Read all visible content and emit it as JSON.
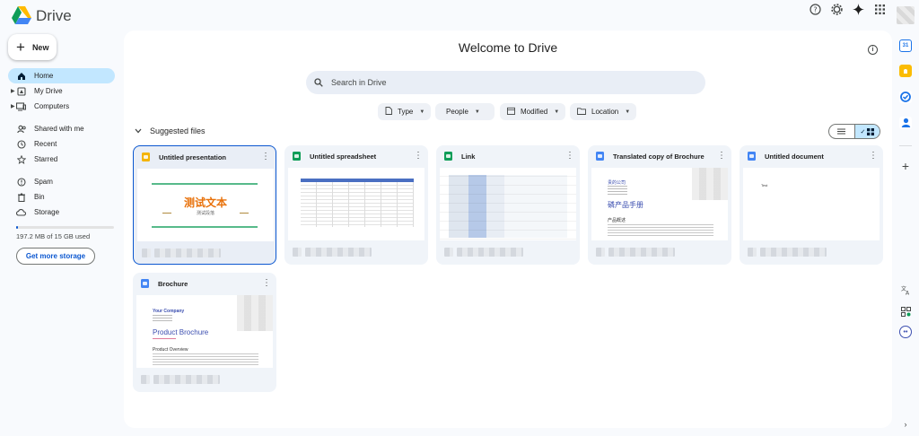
{
  "app": {
    "title": "Drive"
  },
  "topbar": {
    "icons": [
      "help-icon",
      "settings-icon",
      "gemini-icon",
      "apps-grid-icon"
    ]
  },
  "sidebar": {
    "new_label": "New",
    "items": [
      {
        "label": "Home",
        "icon": "home-icon",
        "active": true
      },
      {
        "label": "My Drive",
        "icon": "my-drive-icon",
        "expandable": true
      },
      {
        "label": "Computers",
        "icon": "computers-icon",
        "expandable": true
      },
      {
        "label": "Shared with me",
        "icon": "shared-icon"
      },
      {
        "label": "Recent",
        "icon": "clock-icon"
      },
      {
        "label": "Starred",
        "icon": "star-icon"
      },
      {
        "label": "Spam",
        "icon": "spam-icon"
      },
      {
        "label": "Bin",
        "icon": "bin-icon"
      },
      {
        "label": "Storage",
        "icon": "cloud-icon"
      }
    ],
    "storage": {
      "used_text": "197.2 MB of 15 GB used",
      "used_fraction": 0.013,
      "button_label": "Get more storage"
    }
  },
  "main": {
    "welcome": "Welcome to Drive",
    "search_placeholder": "Search in Drive",
    "filters": [
      {
        "label": "Type",
        "icon": "file-icon"
      },
      {
        "label": "People",
        "icon": ""
      },
      {
        "label": "Modified",
        "icon": "calendar-icon"
      },
      {
        "label": "Location",
        "icon": "folder-icon"
      }
    ],
    "section_title": "Suggested files",
    "files": [
      {
        "name": "Untitled presentation",
        "type": "slides",
        "selected": true,
        "thumb": {
          "title": "测试文本",
          "subtitle": "测试段落"
        }
      },
      {
        "name": "Untitled spreadsheet",
        "type": "sheets"
      },
      {
        "name": "Link",
        "type": "sheets"
      },
      {
        "name": "Translated copy of Brochure",
        "type": "docs",
        "thumb": {
          "company": "贵的公司",
          "title": "磷产品手册",
          "section": "产品概述"
        }
      },
      {
        "name": "Untitled document",
        "type": "docs",
        "thumb": {
          "text": "Test"
        }
      },
      {
        "name": "Brochure",
        "type": "docs",
        "thumb": {
          "company": "Your Company",
          "title": "Product Brochure",
          "section": "Product Overview"
        }
      }
    ]
  },
  "colors": {
    "accent": "#0b57d0",
    "active_nav": "#c2e7ff",
    "main_bg": "#ffffff",
    "page_bg": "#f8fafd"
  }
}
